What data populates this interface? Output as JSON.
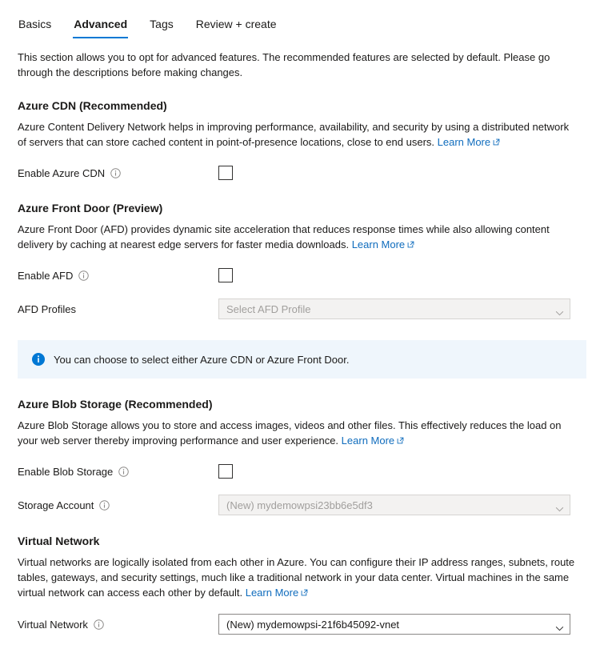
{
  "tabs": [
    {
      "label": "Basics",
      "active": false
    },
    {
      "label": "Advanced",
      "active": true
    },
    {
      "label": "Tags",
      "active": false
    },
    {
      "label": "Review + create",
      "active": false
    }
  ],
  "intro": "This section allows you to opt for advanced features. The recommended features are selected by default. Please go through the descriptions before making changes.",
  "learn_more_label": "Learn More",
  "sections": {
    "cdn": {
      "title": "Azure CDN (Recommended)",
      "description": "Azure Content Delivery Network helps in improving performance, availability, and security by using a distributed network of servers that can store cached content in point-of-presence locations, close to end users.",
      "enable_label": "Enable Azure CDN",
      "enable_checked": false
    },
    "afd": {
      "title": "Azure Front Door (Preview)",
      "description": "Azure Front Door (AFD) provides dynamic site acceleration that reduces response times while also allowing content delivery by caching at nearest edge servers for faster media downloads.",
      "enable_label": "Enable AFD",
      "enable_checked": false,
      "profiles_label": "AFD Profiles",
      "profiles_placeholder": "Select AFD Profile",
      "profiles_disabled": true
    },
    "banner": {
      "text": "You can choose to select either Azure CDN or Azure Front Door."
    },
    "blob": {
      "title": "Azure Blob Storage (Recommended)",
      "description": "Azure Blob Storage allows you to store and access images, videos and other files. This effectively reduces the load on your web server thereby improving performance and user experience.",
      "enable_label": "Enable Blob Storage",
      "enable_checked": false,
      "storage_label": "Storage Account",
      "storage_value": "(New) mydemowpsi23bb6e5df3",
      "storage_disabled": true
    },
    "vnet": {
      "title": "Virtual Network",
      "description": "Virtual networks are logically isolated from each other in Azure. You can configure their IP address ranges, subnets, route tables, gateways, and security settings, much like a traditional network in your data center. Virtual machines in the same virtual network can access each other by default.",
      "vnet_label": "Virtual Network",
      "vnet_value": "(New) mydemowpsi-21f6b45092-vnet",
      "vnet_disabled": false
    }
  },
  "colors": {
    "accent": "#0078d4",
    "link": "#0f6cbd",
    "banner_bg": "#eff6fc"
  }
}
